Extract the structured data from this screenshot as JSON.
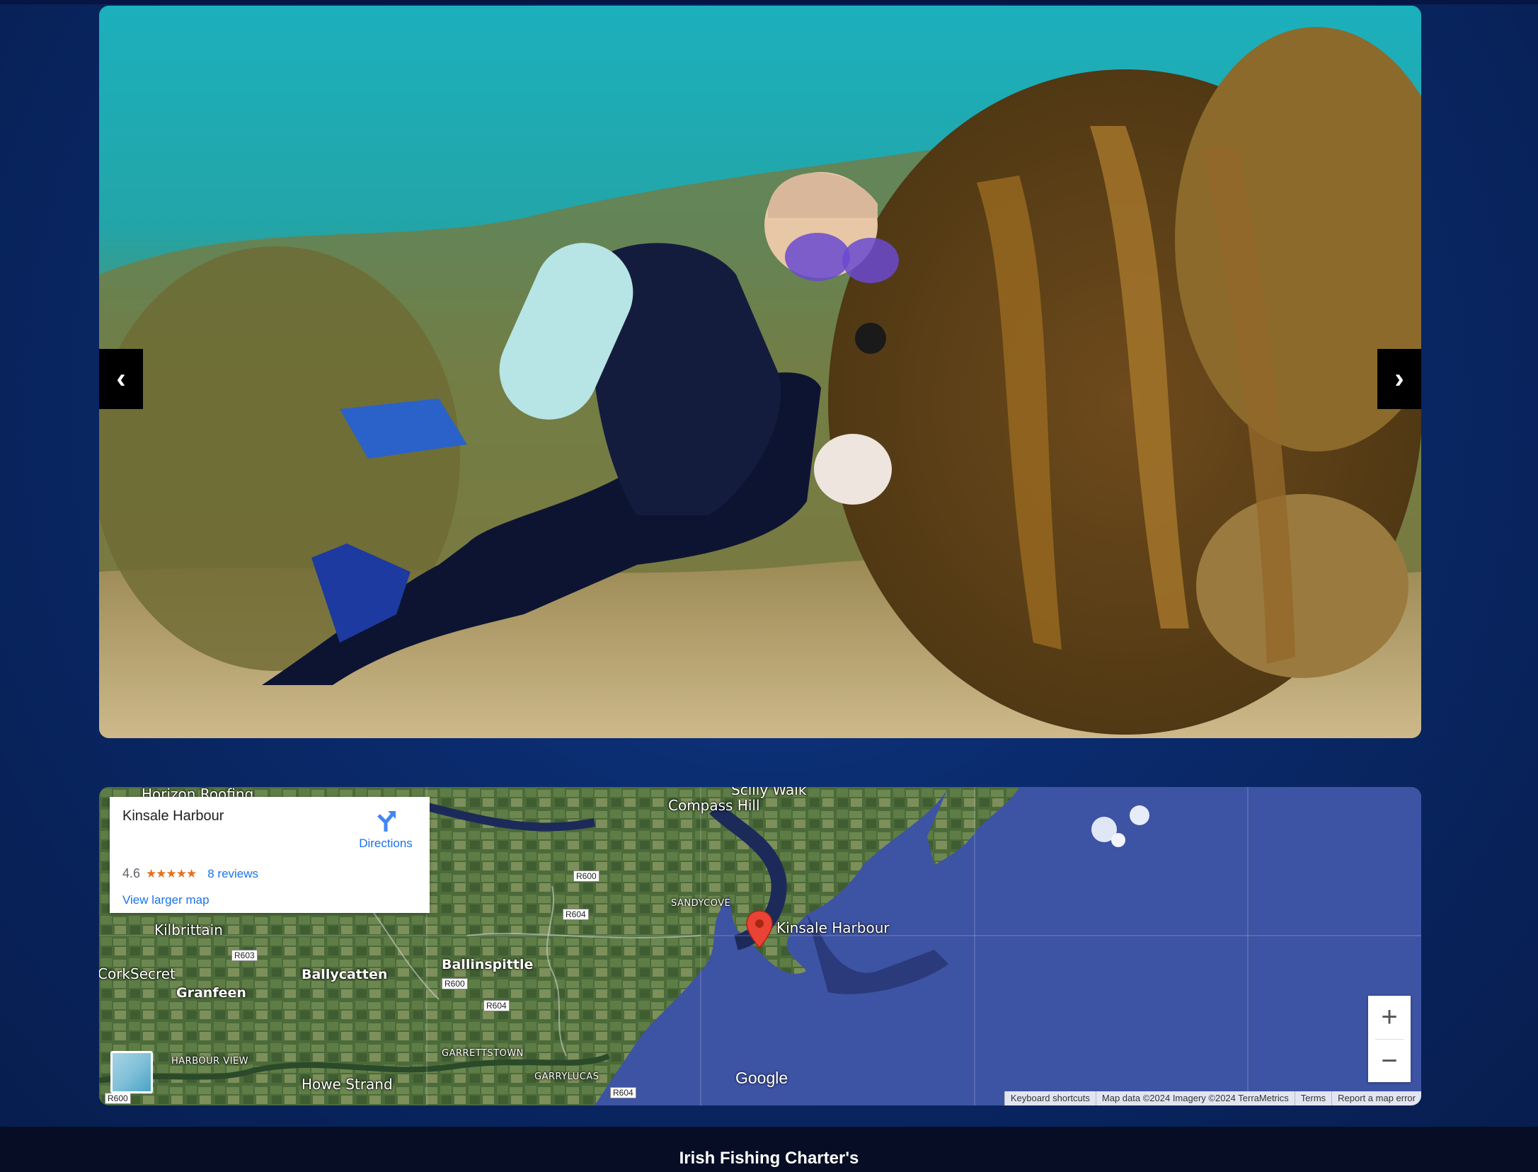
{
  "slider": {
    "prev_label": "‹",
    "next_label": "›",
    "image_alt": "Scuba diver beside kelp underwater"
  },
  "map": {
    "card": {
      "place_name": "Kinsale Harbour",
      "directions_label": "Directions",
      "rating": "4.6",
      "stars": "★★★★★",
      "reviews_label": "8 reviews",
      "larger_map_label": "View larger map"
    },
    "pin_label": "Kinsale Harbour",
    "labels": {
      "horizon_roofing": "Horizon Roofing",
      "scilly_walk": "Scilly Walk",
      "compass_hill": "Compass Hill",
      "sandycove": "SANDYCOVE",
      "kilbrittain": "Kilbrittain",
      "corksecret": "CorkSecret",
      "ballycatten": "Ballycatten",
      "ballinspittle": "Ballinspittle",
      "granfeen": "Granfeen",
      "harbour_view": "HARBOUR VIEW",
      "garrettstown": "GARRETTSTOWN",
      "garrylucas": "GARRYLUCAS",
      "howe_strand": "Howe Strand"
    },
    "roads": {
      "r600_top": "R600",
      "r604_top": "R604",
      "r603": "R603",
      "r600_mid": "R600",
      "r604_mid": "R604",
      "r604_bottom": "R604",
      "r600_bottom": "R600"
    },
    "zoom_in": "+",
    "zoom_out": "−",
    "google_logo": "Google",
    "attribution": {
      "shortcuts": "Keyboard shortcuts",
      "data": "Map data ©2024 Imagery ©2024 TerraMetrics",
      "terms": "Terms",
      "report": "Report a map error"
    }
  },
  "footer": {
    "brand": "Irish Fishing Charter's"
  },
  "colors": {
    "page_bg": "#0a2a6b",
    "footer_bg": "#060d24",
    "link_blue": "#1a73e8",
    "star_orange": "#e7711b",
    "pin_red": "#ea4335"
  }
}
